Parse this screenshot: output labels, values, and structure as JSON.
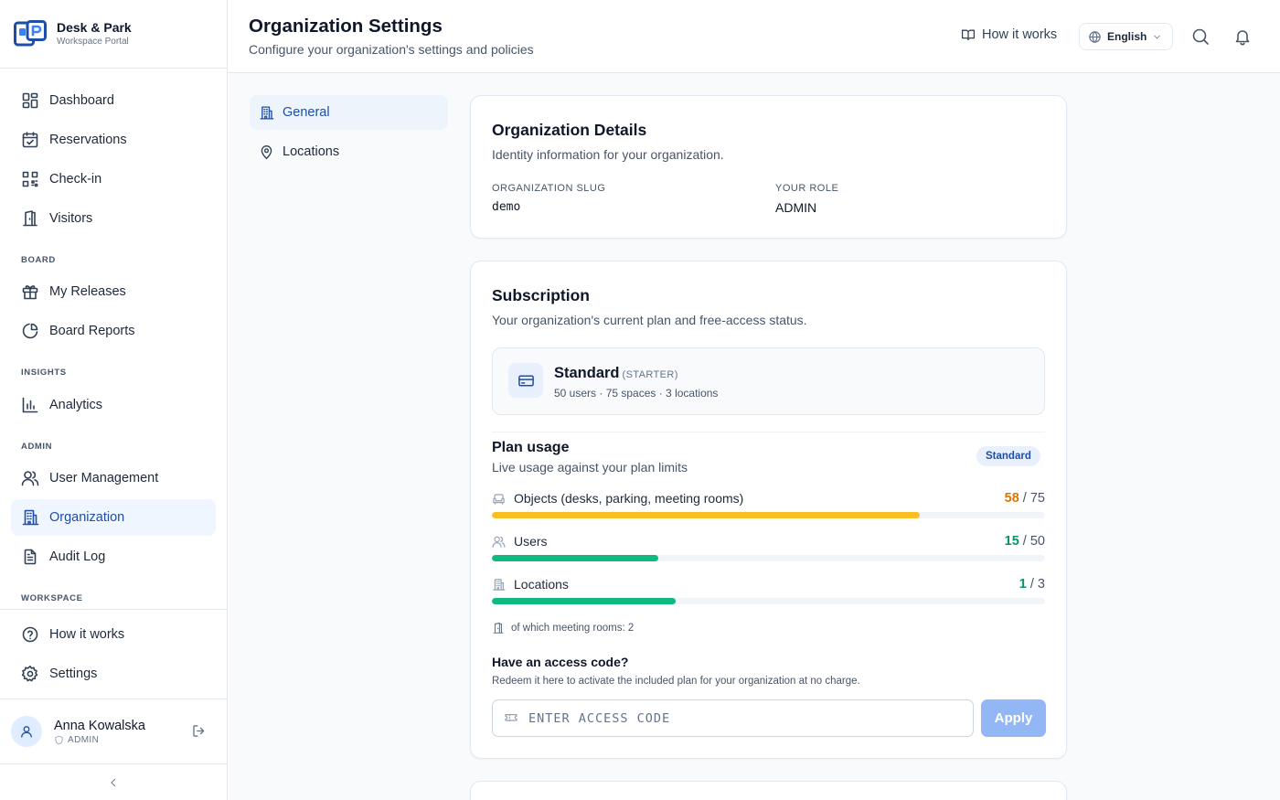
{
  "brand": {
    "name": "Desk & Park",
    "subtitle": "Workspace Portal"
  },
  "sidebar": {
    "items": [
      {
        "label": "Dashboard"
      },
      {
        "label": "Reservations"
      },
      {
        "label": "Check-in"
      },
      {
        "label": "Visitors"
      },
      {
        "label": "My Releases"
      },
      {
        "label": "Board Reports"
      },
      {
        "label": "Analytics"
      },
      {
        "label": "User Management"
      },
      {
        "label": "Organization",
        "active": true
      },
      {
        "label": "Audit Log"
      },
      {
        "label": "How it works"
      },
      {
        "label": "Settings"
      }
    ],
    "sections": {
      "board": "BOARD",
      "insights": "INSIGHTS",
      "admin": "ADMIN",
      "workspace": "WORKSPACE"
    },
    "user": {
      "name": "Anna Kowalska",
      "role": "ADMIN"
    }
  },
  "header": {
    "title": "Organization Settings",
    "subtitle": "Configure your organization's settings and policies",
    "how_it_works": "How it works",
    "language": "English"
  },
  "subnav": {
    "general": "General",
    "locations": "Locations"
  },
  "org_details": {
    "title": "Organization Details",
    "subtitle": "Identity information for your organization.",
    "slug_label": "ORGANIZATION SLUG",
    "slug_value": "demo",
    "role_label": "YOUR ROLE",
    "role_value": "ADMIN"
  },
  "subscription": {
    "title": "Subscription",
    "subtitle": "Your organization's current plan and free-access status.",
    "plan_name": "Standard",
    "plan_tier": "(STARTER)",
    "plan_meta": "50 users · 75 spaces · 3 locations",
    "usage_title": "Plan usage",
    "usage_subtitle": "Live usage against your plan limits",
    "badge": "Standard",
    "usage": [
      {
        "label": "Objects (desks, parking, meeting rooms)",
        "used": "58",
        "sep": " / ",
        "limit": "75",
        "fraction": 0.773,
        "color": "#fbbf24",
        "count_color": "#d97706"
      },
      {
        "label": "Users",
        "used": "15",
        "sep": " / ",
        "limit": "50",
        "fraction": 0.3,
        "color": "#10b981",
        "count_color": "#059669"
      },
      {
        "label": "Locations",
        "used": "1",
        "sep": " / ",
        "limit": "3",
        "fraction": 0.333,
        "color": "#10b981",
        "count_color": "#059669"
      }
    ],
    "meeting_note": "of which meeting rooms: 2",
    "code_title": "Have an access code?",
    "code_subtitle": "Redeem it here to activate the included plan for your organization at no charge.",
    "code_placeholder": "ENTER ACCESS CODE",
    "apply_label": "Apply"
  }
}
